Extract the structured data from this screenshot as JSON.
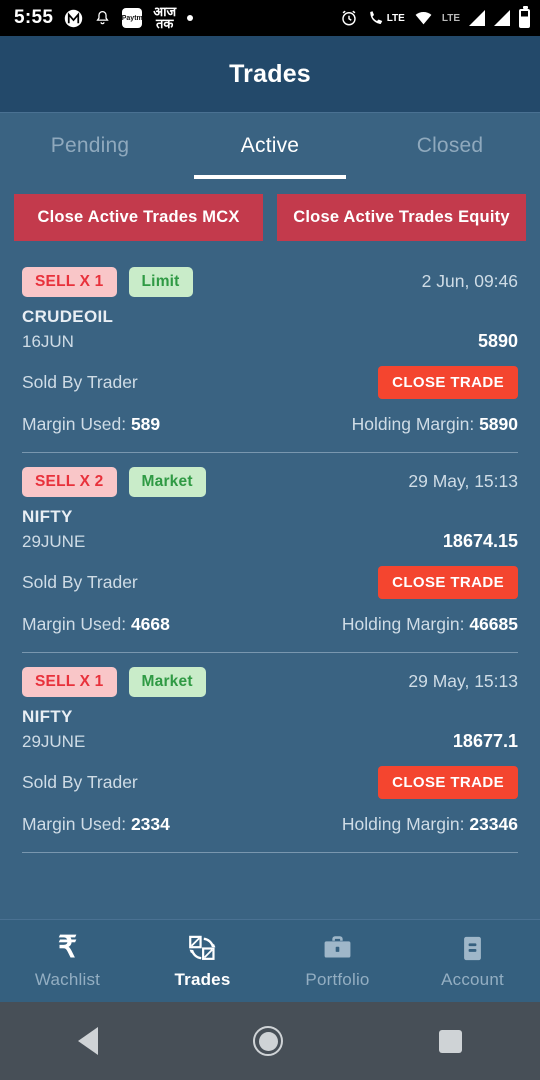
{
  "status_bar": {
    "time": "5:55",
    "left_icons": [
      "maps-app-icon",
      "bell-icon",
      "paytm-app-icon",
      "aaj-tak-app-icon",
      "dot-indicator"
    ],
    "paytm_label": "Paytm",
    "hindi_label_line1": "आज",
    "hindi_label_line2": "तक",
    "right_icons": [
      "alarm-icon",
      "call-lte-icon",
      "wifi-icon",
      "signal-bar-icon",
      "signal-bar-icon",
      "battery-icon"
    ],
    "lte_label": "LTE",
    "lte_label_2": "LTE"
  },
  "header": {
    "title": "Trades"
  },
  "tabs": [
    {
      "label": "Pending",
      "active": false
    },
    {
      "label": "Active",
      "active": true
    },
    {
      "label": "Closed",
      "active": false
    }
  ],
  "actions": [
    {
      "label": "Close Active Trades MCX"
    },
    {
      "label": "Close Active Trades Equity"
    }
  ],
  "trades": [
    {
      "side": "SELL X 1",
      "order_type": "Limit",
      "timestamp": "2 Jun, 09:46",
      "symbol": "CRUDEOIL",
      "expiry": "16JUN",
      "price": "5890",
      "status": "Sold By Trader",
      "close_label": "CLOSE TRADE",
      "margin_used_label": "Margin Used:",
      "margin_used": "589",
      "holding_margin_label": "Holding Margin:",
      "holding_margin": "5890"
    },
    {
      "side": "SELL X 2",
      "order_type": "Market",
      "timestamp": "29 May, 15:13",
      "symbol": "NIFTY",
      "expiry": "29JUNE",
      "price": "18674.15",
      "status": "Sold By Trader",
      "close_label": "CLOSE TRADE",
      "margin_used_label": "Margin Used:",
      "margin_used": "4668",
      "holding_margin_label": "Holding Margin:",
      "holding_margin": "46685"
    },
    {
      "side": "SELL X 1",
      "order_type": "Market",
      "timestamp": "29 May, 15:13",
      "symbol": "NIFTY",
      "expiry": "29JUNE",
      "price": "18677.1",
      "status": "Sold By Trader",
      "close_label": "CLOSE TRADE",
      "margin_used_label": "Margin Used:",
      "margin_used": "2334",
      "holding_margin_label": "Holding Margin:",
      "holding_margin": "23346"
    }
  ],
  "bottom_nav": [
    {
      "label": "Wachlist",
      "icon": "rupee-icon",
      "active": false
    },
    {
      "label": "Trades",
      "icon": "exchange-icon",
      "active": true
    },
    {
      "label": "Portfolio",
      "icon": "briefcase-icon",
      "active": false
    },
    {
      "label": "Account",
      "icon": "id-card-icon",
      "active": false
    }
  ],
  "android_nav": [
    "back-icon",
    "home-icon",
    "recents-icon"
  ],
  "colors": {
    "header_bg": "#23496a",
    "body_bg": "#3a6382",
    "action_red": "#c33a4c",
    "close_trade_red": "#f4452f",
    "badge_sell_bg": "#f9c6c8",
    "badge_sell_text": "#e8313b",
    "badge_type_bg": "#c9ecc9",
    "badge_type_text": "#2f9a44",
    "nav_bg": "#35607f"
  }
}
